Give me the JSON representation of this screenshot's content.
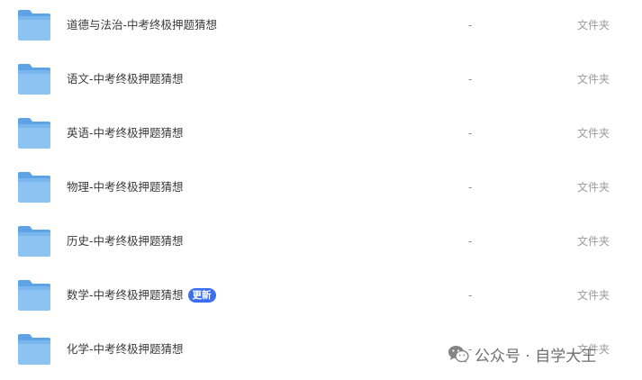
{
  "colors": {
    "folder": "#7db7ee",
    "folder_tab": "#5ea3e6",
    "badge": "#3b6ef5",
    "text": "#3a3a3a",
    "muted": "#9a9a9a"
  },
  "files": [
    {
      "name": "道德与法治-中考终极押题猜想",
      "size": "-",
      "type": "文件夹",
      "icon": "folder-icon"
    },
    {
      "name": "语文-中考终极押题猜想",
      "size": "-",
      "type": "文件夹",
      "icon": "folder-icon"
    },
    {
      "name": "英语-中考终极押题猜想",
      "size": "-",
      "type": "文件夹",
      "icon": "folder-icon"
    },
    {
      "name": "物理-中考终极押题猜想",
      "size": "-",
      "type": "文件夹",
      "icon": "folder-icon"
    },
    {
      "name": "历史-中考终极押题猜想",
      "size": "-",
      "type": "文件夹",
      "icon": "folder-icon"
    },
    {
      "name": "数学-中考终极押题猜想",
      "size": "-",
      "type": "文件夹",
      "icon": "folder-icon",
      "badge": "更新"
    },
    {
      "name": "化学-中考终极押题猜想",
      "size": "-",
      "type": "文件夹",
      "icon": "folder-icon"
    }
  ],
  "watermark": {
    "text": "公众号 · 自学大王",
    "icon": "wechat-logo-icon"
  }
}
